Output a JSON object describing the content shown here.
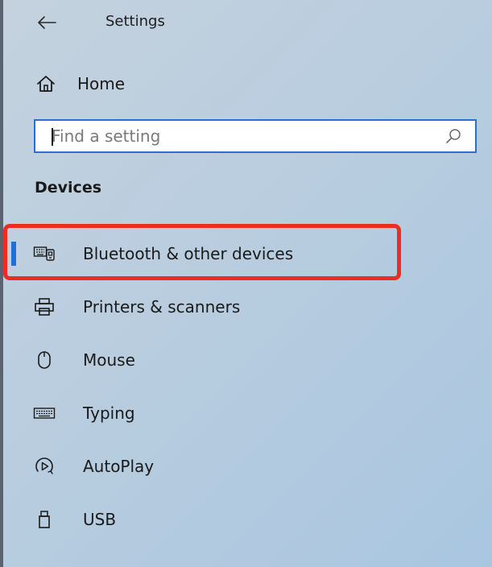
{
  "window": {
    "title": "Settings"
  },
  "home": {
    "label": "Home",
    "icon": "home-icon"
  },
  "search": {
    "placeholder": "Find a setting",
    "value": "",
    "icon": "search-icon"
  },
  "section": {
    "title": "Devices"
  },
  "nav_items": [
    {
      "label": "Bluetooth & other devices",
      "icon": "bluetooth-devices-icon",
      "selected": true
    },
    {
      "label": "Printers & scanners",
      "icon": "printer-icon",
      "selected": false
    },
    {
      "label": "Mouse",
      "icon": "mouse-icon",
      "selected": false
    },
    {
      "label": "Typing",
      "icon": "keyboard-icon",
      "selected": false
    },
    {
      "label": "AutoPlay",
      "icon": "autoplay-icon",
      "selected": false
    },
    {
      "label": "USB",
      "icon": "usb-icon",
      "selected": false
    }
  ],
  "colors": {
    "accent": "#1f6fd8",
    "search_border": "#2a6fd6",
    "highlight": "#ec2d22"
  }
}
